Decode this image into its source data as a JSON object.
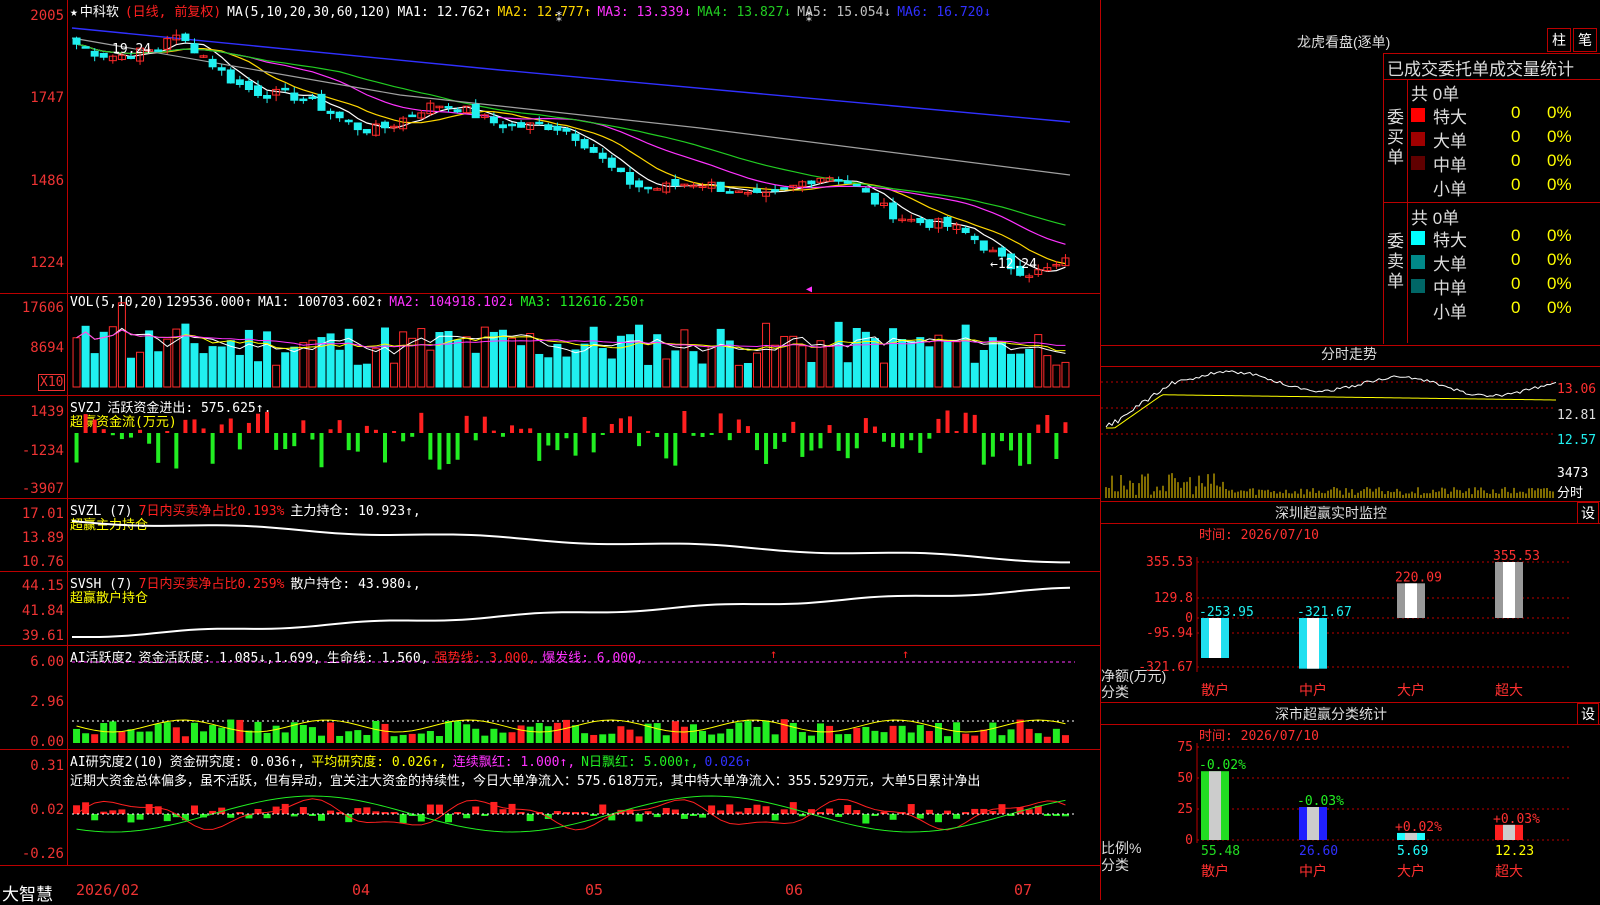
{
  "stock": {
    "star": "★",
    "name": "中科软",
    "mode": "(日线, 前复权)"
  },
  "colors": {
    "up": "#ff2b2b",
    "down": "#20f0f0",
    "ma1": "#ffffff",
    "ma2": "#ffd700",
    "ma3": "#ff33ff",
    "ma4": "#22cc22",
    "ma5": "#a0a0a0",
    "ma6": "#3030ff",
    "green": "#22ee22",
    "red": "#ff2020",
    "yellow": "#ffff00"
  },
  "main": {
    "ma_label": "MA(5,10,20,30,60,120)",
    "items": [
      {
        "k": "MA1:",
        "v": "12.762↑",
        "c": "#ffffff"
      },
      {
        "k": "MA2:",
        "v": "12.777↑",
        "c": "#ffd700"
      },
      {
        "k": "MA3:",
        "v": "13.339↓",
        "c": "#ff33ff"
      },
      {
        "k": "MA4:",
        "v": "13.827↓",
        "c": "#22cc22"
      },
      {
        "k": "MA5:",
        "v": "15.054↓",
        "c": "#c0c0c0"
      },
      {
        "k": "MA6:",
        "v": "16.720↓",
        "c": "#3030ff"
      }
    ],
    "ticks": [
      "2005",
      "1747",
      "1486",
      "1224"
    ],
    "high_label": "19.24",
    "low_label": "←12.24"
  },
  "vol": {
    "label": "VOL(5,10,20)",
    "value": "129536.000↑",
    "items": [
      {
        "k": "MA1:",
        "v": "100703.602↑",
        "c": "#ffffff"
      },
      {
        "k": "MA2:",
        "v": "104918.102↓",
        "c": "#ff33ff"
      },
      {
        "k": "MA3:",
        "v": "112616.250↑",
        "c": "#22ee22"
      }
    ],
    "ticks": [
      "17606",
      "8694"
    ],
    "unit": "X10"
  },
  "svzj": {
    "label": "SVZJ",
    "item": "活跃资金进出: 575.625↑,",
    "sub": "超赢资金流(万元)",
    "ticks": [
      "1439",
      "-1234",
      "-3907"
    ]
  },
  "svzl": {
    "label": "SVZL (7)",
    "pct": "7日内买卖净占比0.193%",
    "item": "主力持仓: 10.923↑,",
    "sub": "超赢主力持仓",
    "ticks": [
      "17.01",
      "13.89",
      "10.76"
    ]
  },
  "svsh": {
    "label": "SVSH (7)",
    "pct": "7日内买卖净占比0.259%",
    "item": "散户持仓: 43.980↓,",
    "sub": "超赢散户持仓",
    "ticks": [
      "44.15",
      "41.84",
      "39.61"
    ]
  },
  "ai1": {
    "label": "AI活跃度2",
    "items": [
      "资金活跃度: 1.085↓,1.699,",
      "生命线: 1.560,"
    ],
    "strong": "强势线: 3.000,",
    "burst": "爆发线: 6.000,",
    "ticks": [
      "6.00",
      "2.96",
      "0.00"
    ]
  },
  "ai2": {
    "label": "AI研究度2(10)",
    "item": "资金研究度: 0.036↑,",
    "avg": "平均研究度: 0.026↑,",
    "lianxu": "连续飘红: 1.000↑,",
    "nri": "N日飘红: 5.000↑,",
    "last": "0.026↑",
    "text": "近期大资金总体偏多，虽不活跃，但有异动，宜关注大资金的持续性，今日大单净流入：575.618万元，其中特大单净流入：355.529万元，大单5日累计净出",
    "ticks": [
      "0.31",
      "0.02",
      "-0.26"
    ]
  },
  "xaxis": {
    "brand": "大智慧",
    "labels": [
      "2026/02",
      "04",
      "05",
      "06",
      "07"
    ]
  },
  "lhb": {
    "title": "龙虎看盘(逐单)",
    "btn1": "柱",
    "btn2": "笔",
    "heading": "已成交委托单成交量统计",
    "buy": {
      "side": "委买单",
      "total": "共 0单",
      "rows": [
        {
          "n": "特大",
          "v": "0",
          "p": "0%",
          "c": "#ff0000"
        },
        {
          "n": "大单",
          "v": "0",
          "p": "0%",
          "c": "#a00000"
        },
        {
          "n": "中单",
          "v": "0",
          "p": "0%",
          "c": "#600000"
        },
        {
          "n": "小单",
          "v": "0",
          "p": "0%",
          "c": "#000000"
        }
      ]
    },
    "sell": {
      "side": "委卖单",
      "total": "共 0单",
      "rows": [
        {
          "n": "特大",
          "v": "0",
          "p": "0%",
          "c": "#00ffff"
        },
        {
          "n": "大单",
          "v": "0",
          "p": "0%",
          "c": "#008888"
        },
        {
          "n": "中单",
          "v": "0",
          "p": "0%",
          "c": "#006666"
        },
        {
          "n": "小单",
          "v": "0",
          "p": "0%",
          "c": "#000000"
        }
      ]
    }
  },
  "fenshi": {
    "title": "分时走势",
    "ticks": [
      "13.06",
      "12.81",
      "12.57"
    ],
    "vol_tick": "3473",
    "vol_unit": "分时"
  },
  "sz_monitor": {
    "title": "深圳超赢实时监控",
    "btn": "设",
    "time": "时间: 2026/07/10",
    "ticks": [
      "355.53",
      "129.8",
      "0",
      "-95.94",
      "-321.67"
    ],
    "ylab1": "净额(万元)",
    "ylab2": "分类",
    "bars": [
      {
        "cat": "散户",
        "val": "-253.95"
      },
      {
        "cat": "中户",
        "val": "-321.67"
      },
      {
        "cat": "大户",
        "val": "220.09"
      },
      {
        "cat": "超大",
        "val": "355.53"
      }
    ]
  },
  "sz_class": {
    "title": "深市超赢分类统计",
    "btn": "设",
    "time": "时间: 2026/07/10",
    "ticks": [
      "75",
      "50",
      "25",
      "0"
    ],
    "ylab1": "比例%",
    "ylab2": "分类",
    "bars": [
      {
        "cat": "散户",
        "pct": "-0.02%",
        "val": "55.48",
        "c": "#22dd22"
      },
      {
        "cat": "中户",
        "pct": "-0.03%",
        "val": "26.60",
        "c": "#2020ff"
      },
      {
        "cat": "大户",
        "pct": "+0.02%",
        "val": "5.69",
        "c": "#20ffff"
      },
      {
        "cat": "超大",
        "pct": "+0.03%",
        "val": "12.23",
        "c": "#ff2020"
      }
    ]
  }
}
